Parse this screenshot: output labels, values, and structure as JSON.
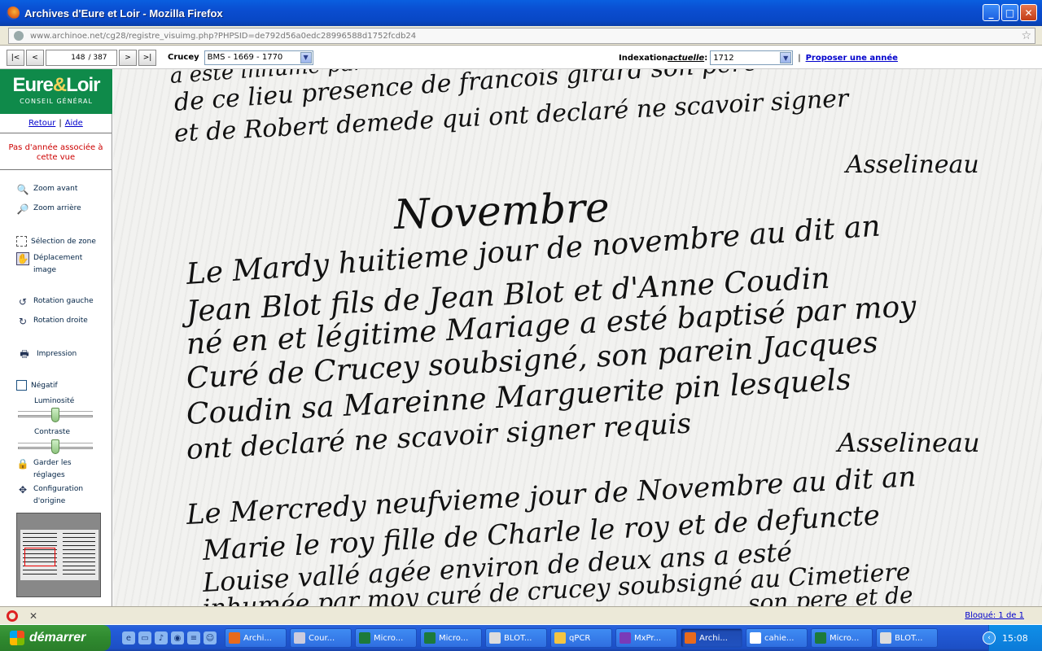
{
  "window": {
    "title": "Archives d'Eure et Loir - Mozilla Firefox",
    "minimize": "_",
    "maximize": "□",
    "close": "✕"
  },
  "browser": {
    "url": "www.archinoe.net/cg28/registre_visuimg.php?PHPSID=de792d56a0edc28996588d1752fcdb24",
    "star": "☆"
  },
  "viewer": {
    "nav": {
      "first": "|<",
      "prev": "<",
      "current_page": "148",
      "total_pages": "/ 387",
      "next": ">",
      "last": ">|"
    },
    "commune_label": "Crucey",
    "register_select": "BMS - 1669 - 1770",
    "indexation": {
      "prefix": "Indexation ",
      "emph": "actuelle",
      "suffix": " :",
      "value": "1712",
      "sep": "|",
      "propose": "Proposer une année"
    }
  },
  "sidebar": {
    "logo": {
      "eure": "Eure",
      "amp": "&",
      "loir": "Loir",
      "sub": "CONSEIL GÉNÉRAL"
    },
    "links": {
      "back": "Retour",
      "sep": "|",
      "help": "Aide"
    },
    "no_year": "Pas d'année associée à cette vue",
    "tools": {
      "zoom_in": "Zoom avant",
      "zoom_out": "Zoom arrière",
      "select_zone": "Sélection de zone",
      "move_1": "Déplacement",
      "move_2": "image",
      "rot_left": "Rotation gauche",
      "rot_right": "Rotation droite",
      "print": "Impression",
      "negative": "Négatif",
      "luminosity": "Luminosité",
      "contrast": "Contraste",
      "keep_1": "Garder les",
      "keep_2": "réglages",
      "reset_1": "Configuration",
      "reset_2": "d'origine"
    },
    "luminosity_level": 0.5,
    "contrast_level": 0.5
  },
  "manuscript": {
    "lines": [
      "a esté inhumé par ...",
      "de ce lieu presence de francois girard son pere",
      "et de Robert demede qui ont declaré ne scavoir signer",
      "Asselineau",
      "Novembre",
      "Le Mardy huitieme jour de novembre au dit an",
      "Jean Blot fils de Jean Blot et d'Anne Coudin",
      "né en et légitime Mariage a esté baptisé par moy",
      "Curé de Crucey soubsigné, son parein Jacques",
      "Coudin sa Mareinne Marguerite pin lesquels",
      "ont declaré ne scavoir signer requis",
      "Asselineau",
      "Le Mercredy neufvieme jour de Novembre au dit an",
      "Marie le roy fille de Charle le roy et de defuncte",
      "Louise vallé agée environ de deux ans a esté",
      "inhumée par moy curé de crucey soubsigné au Cimetiere",
      "son pere et de"
    ]
  },
  "status": {
    "stop": "✕",
    "blocked": "Bloqué: 1 de 1"
  },
  "taskbar": {
    "start": "démarrer",
    "tasks": [
      "Archi...",
      "Cour...",
      "Micro...",
      "Micro...",
      "BLOT...",
      "qPCR",
      "MxPr...",
      "Archi...",
      "cahie...",
      "Micro...",
      "BLOT..."
    ],
    "time": "15:08"
  }
}
